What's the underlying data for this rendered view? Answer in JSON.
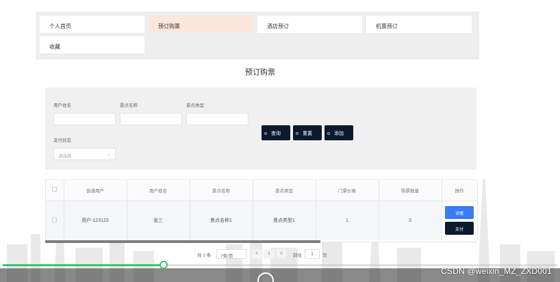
{
  "nav": {
    "items": [
      {
        "label": "个人首页",
        "active": false
      },
      {
        "label": "预订购票",
        "active": true
      },
      {
        "label": "酒店预订",
        "active": false
      },
      {
        "label": "机票预订",
        "active": false
      },
      {
        "label": "收藏",
        "active": false
      }
    ]
  },
  "page": {
    "title": "预订购票"
  },
  "search": {
    "fields": [
      {
        "label": "用户姓名",
        "value": ""
      },
      {
        "label": "景点名称",
        "value": ""
      },
      {
        "label": "景点类型",
        "value": ""
      }
    ],
    "status": {
      "label": "支付状态",
      "placeholder": "请选择"
    },
    "buttons": {
      "query": "查询",
      "reset": "重置",
      "add": "添加"
    }
  },
  "table": {
    "headers": [
      "",
      "普通用户",
      "用户姓名",
      "景点名称",
      "景点类型",
      "门票价格",
      "购票数量",
      "操作"
    ],
    "rows": [
      {
        "user": "用户-123123",
        "name": "张三",
        "spot": "景点名称1",
        "type": "景点类型1",
        "price": "1",
        "qty": "3"
      }
    ],
    "actions": {
      "detail": "详情",
      "pay": "支付"
    }
  },
  "pager": {
    "total": "共 1 条",
    "page_size": "7条/页",
    "prev": "<",
    "current": "1",
    "next": ">",
    "goto_label": "前往",
    "goto_value": "1",
    "page_unit": "页"
  },
  "video": {
    "progress": 0.29,
    "watermark": "CSDN @weixin_MZ_ZXD001"
  },
  "colors": {
    "accent_blue": "#3b7cf5",
    "dark_button": "#0b1a2e",
    "nav_active": "#fbe7dc",
    "progress_green": "#39c46c"
  }
}
